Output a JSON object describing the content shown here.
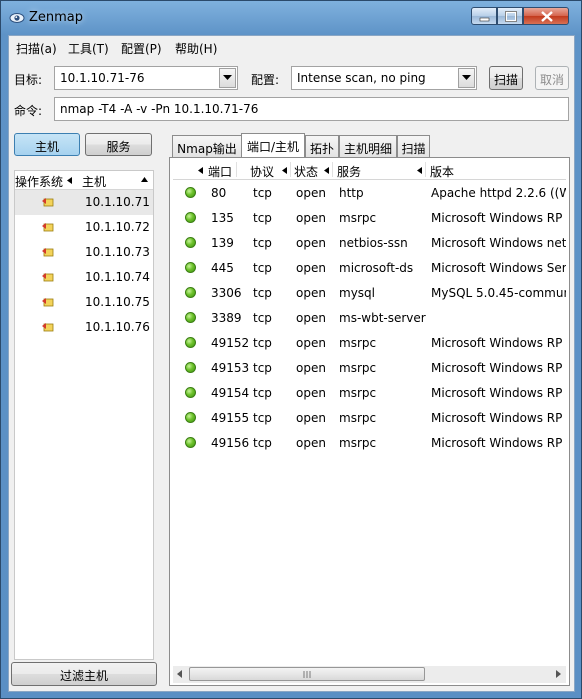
{
  "app": {
    "title": "Zenmap"
  },
  "menu": [
    "扫描(a)",
    "工具(T)",
    "配置(P)",
    "帮助(H)"
  ],
  "toolbar": {
    "target_label": "目标:",
    "target_value": "10.1.10.71-76",
    "profile_label": "配置:",
    "profile_value": "Intense scan, no ping",
    "scan_button": "扫描",
    "cancel_button": "取消",
    "command_label": "命令:",
    "command_value": "nmap -T4 -A -v -Pn 10.1.10.71-76"
  },
  "left_panel": {
    "hosts_button": "主机",
    "services_button": "服务",
    "col_os": "操作系统",
    "col_host": "主机",
    "hosts": [
      "10.1.10.71",
      "10.1.10.72",
      "10.1.10.73",
      "10.1.10.74",
      "10.1.10.75",
      "10.1.10.76"
    ],
    "filter_button": "过滤主机"
  },
  "tabs": [
    "Nmap输出",
    "端口/主机",
    "拓扑",
    "主机明细",
    "扫描"
  ],
  "ports_table": {
    "columns": {
      "port": "端口",
      "protocol": "协议",
      "state": "状态",
      "service": "服务",
      "version": "版本"
    },
    "rows": [
      {
        "port": "80",
        "protocol": "tcp",
        "state": "open",
        "service": "http",
        "version": "Apache httpd 2.2.6 ((W"
      },
      {
        "port": "135",
        "protocol": "tcp",
        "state": "open",
        "service": "msrpc",
        "version": "Microsoft Windows RP"
      },
      {
        "port": "139",
        "protocol": "tcp",
        "state": "open",
        "service": "netbios-ssn",
        "version": "Microsoft Windows net"
      },
      {
        "port": "445",
        "protocol": "tcp",
        "state": "open",
        "service": "microsoft-ds",
        "version": "Microsoft Windows Ser"
      },
      {
        "port": "3306",
        "protocol": "tcp",
        "state": "open",
        "service": "mysql",
        "version": "MySQL 5.0.45-commun"
      },
      {
        "port": "3389",
        "protocol": "tcp",
        "state": "open",
        "service": "ms-wbt-server",
        "version": ""
      },
      {
        "port": "49152",
        "protocol": "tcp",
        "state": "open",
        "service": "msrpc",
        "version": "Microsoft Windows RP"
      },
      {
        "port": "49153",
        "protocol": "tcp",
        "state": "open",
        "service": "msrpc",
        "version": "Microsoft Windows RP"
      },
      {
        "port": "49154",
        "protocol": "tcp",
        "state": "open",
        "service": "msrpc",
        "version": "Microsoft Windows RP"
      },
      {
        "port": "49155",
        "protocol": "tcp",
        "state": "open",
        "service": "msrpc",
        "version": "Microsoft Windows RP"
      },
      {
        "port": "49156",
        "protocol": "tcp",
        "state": "open",
        "service": "msrpc",
        "version": "Microsoft Windows RP"
      }
    ]
  },
  "colors": {
    "open_status": "#6cc12a",
    "title_bar": "#7fb1de"
  }
}
